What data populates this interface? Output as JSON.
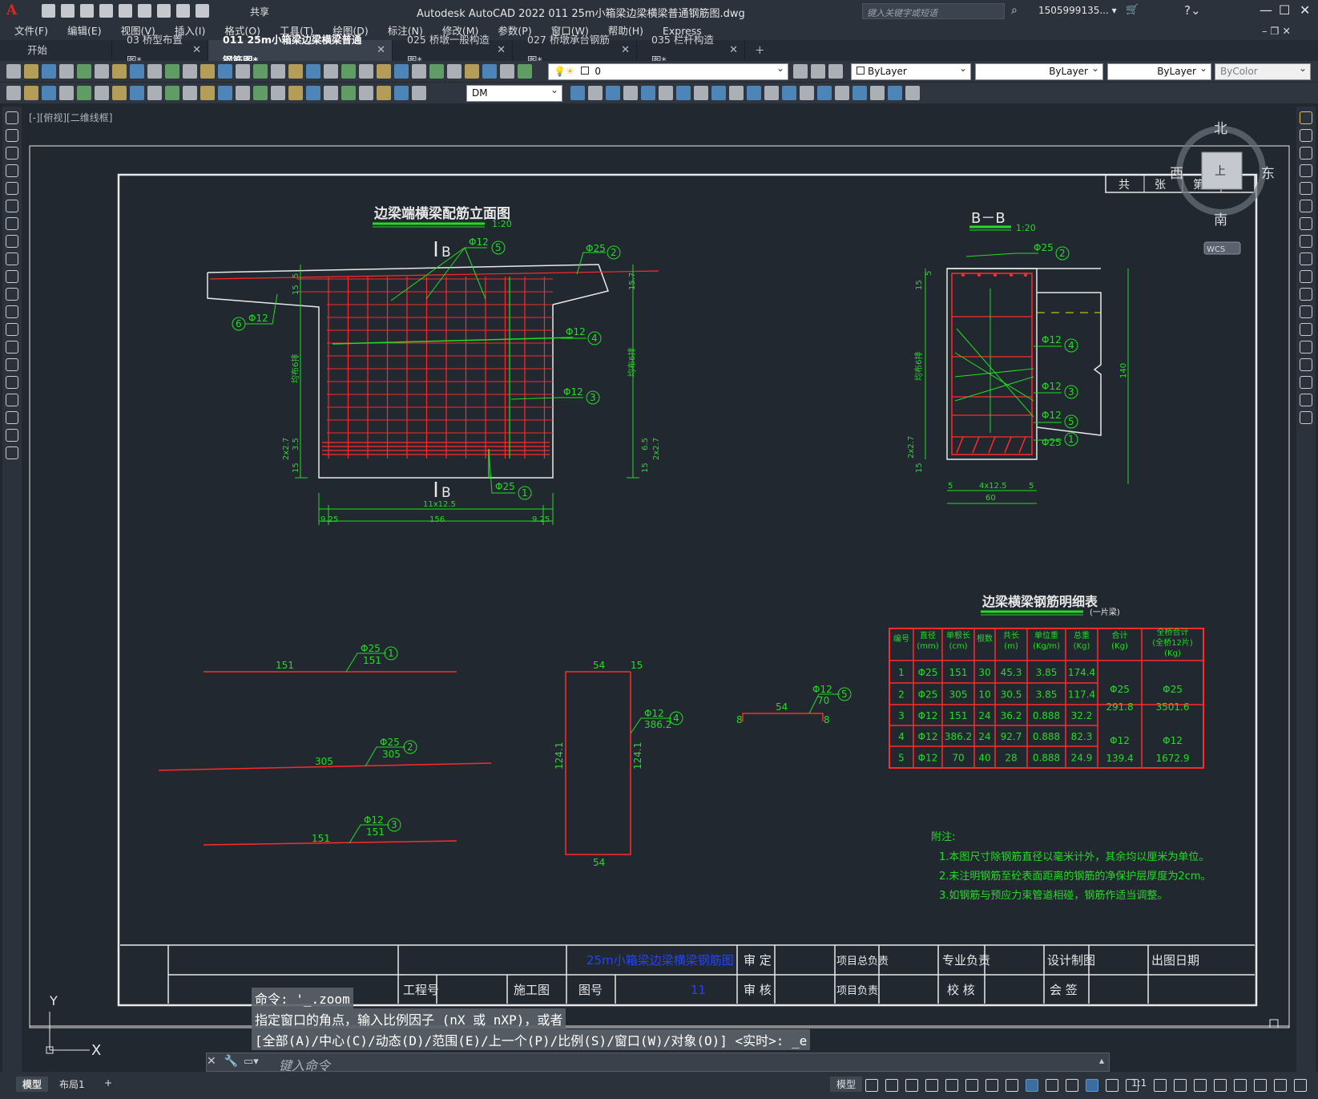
{
  "app": {
    "logo": "A",
    "share": "共享",
    "title": "Autodesk AutoCAD 2022    011 25m小箱梁边梁横梁普通钢筋图.dwg",
    "search_placeholder": "键入关键字或短语",
    "user": "1505999135... ▾"
  },
  "menu": [
    "文件(F)",
    "编辑(E)",
    "视图(V)",
    "插入(I)",
    "格式(O)",
    "工具(T)",
    "绘图(D)",
    "标注(N)",
    "修改(M)",
    "参数(P)",
    "窗口(W)",
    "帮助(H)",
    "Express"
  ],
  "tabs": [
    {
      "label": "开始",
      "closable": false
    },
    {
      "label": "03  桥型布置图*",
      "closable": true
    },
    {
      "label": "011 25m小箱梁边梁横梁普通钢筋图*",
      "closable": true,
      "active": true
    },
    {
      "label": "025 桥墩一般构造图*",
      "closable": true
    },
    {
      "label": "027 桥墩承台钢筋图*",
      "closable": true
    },
    {
      "label": "035 栏杆构造图*",
      "closable": true
    }
  ],
  "toolbar": {
    "layer_value": "0",
    "color": "ByLayer",
    "linetype": "ByLayer",
    "lineweight": "ByLayer",
    "plotstyle": "ByColor",
    "textstyle": "DM"
  },
  "viewport": {
    "label": "[-][俯视][二维线框]",
    "compass": {
      "north": "北",
      "south": "南",
      "east": "东",
      "west": "西",
      "ucs": "WCS"
    },
    "ucs_y": "Y",
    "ucs_x": "X"
  },
  "drawing": {
    "sheet_count": {
      "total": "共",
      "sheets": "张",
      "no": "第",
      "sheet": "张"
    },
    "elevation_title": "边梁端横梁配筋立面图",
    "elevation_scale": "1:20",
    "section_title": "B－B",
    "section_scale": "1:20",
    "section_marks": [
      "B",
      "B"
    ],
    "table_title": "边梁横梁钢筋明细表",
    "table_subtitle": "(一片梁)",
    "table_headers": [
      "编号",
      "直径\n(mm)",
      "单根长\n(cm)",
      "根数",
      "共长\n(m)",
      "单位重\n(Kg/m)",
      "总重\n(Kg)",
      "合计\n(Kg)",
      "全桥合计\n(全桥12片)\n(Kg)"
    ],
    "table_rows": [
      [
        "1",
        "Φ25",
        "151",
        "30",
        "45.3",
        "3.85",
        "174.4"
      ],
      [
        "2",
        "Φ25",
        "305",
        "10",
        "30.5",
        "3.85",
        "117.4"
      ],
      [
        "3",
        "Φ12",
        "151",
        "24",
        "36.2",
        "0.888",
        "32.2"
      ],
      [
        "4",
        "Φ12",
        "386.2",
        "24",
        "92.7",
        "0.888",
        "82.3"
      ],
      [
        "5",
        "Φ12",
        "70",
        "40",
        "28",
        "0.888",
        "24.9"
      ]
    ],
    "table_totals": {
      "d25_label": "Φ25",
      "d25_sum": "291.8",
      "d25_all": "3501.6",
      "d12_label": "Φ12",
      "d12_sum": "139.4",
      "d12_all": "1672.9"
    },
    "notes_title": "附注:",
    "notes": [
      "1.本图尺寸除钢筋直径以毫米计外，其余均以厘米为单位。",
      "2.未注明钢筋至砼表面距离的钢筋的净保护层厚度为2cm。",
      "3.如钢筋与预应力束管道相碰，钢筋作适当调整。"
    ],
    "titleblock": {
      "drawing_name": "25m小箱梁边梁横梁钢筋图",
      "project_no": "工程号",
      "stage": "施工图",
      "drawing_no": "图号",
      "drawing_no_value": "11",
      "approve": "审 定",
      "review": "审 核",
      "pm1": "项目总负责",
      "pm2": "项目负责",
      "specialty": "专业负责",
      "check": "校 核",
      "design": "设计制图",
      "countersign": "会 签",
      "date": "出图日期"
    },
    "bars": {
      "b1": {
        "tag": "Φ25",
        "num": "1",
        "len": "151",
        "side": "151"
      },
      "b2": {
        "tag": "Φ25",
        "num": "2",
        "len": "305",
        "side": "305"
      },
      "b3": {
        "tag": "Φ12",
        "num": "3",
        "len": "151",
        "side": "151"
      },
      "b4": {
        "tag": "Φ12",
        "num": "4",
        "top": "54",
        "top2": "15",
        "h": "124.1",
        "h2": "124.1",
        "bottom": "54",
        "len": "386.2"
      },
      "b5": {
        "tag": "Φ12",
        "num": "5",
        "len": "70",
        "mid": "54",
        "leg": "8"
      }
    },
    "elev_labels": {
      "n1": "Φ25",
      "n2": "Φ25",
      "n3": "Φ12",
      "n4": "Φ12",
      "n5": "Φ12",
      "n6": "Φ12",
      "dim_11x": "11x12.5",
      "dim_156": "156",
      "dim_925a": "9.25",
      "dim_925b": "9.25",
      "dim_5": "5",
      "dim_15": "15",
      "dim_157": "15.7",
      "dim_35": "3.5",
      "dim_2x27": "2x2.7",
      "dim_65": "6.5",
      "dim_15b": "15",
      "dim_spacing": "均布6排"
    },
    "sect_labels": {
      "dim_4x125": "4x12.5",
      "dim_60": "60",
      "dim_5a": "5",
      "dim_5b": "5",
      "dim_140": "140",
      "dim_15": "15",
      "dim_5": "5",
      "dim_2x27": "2x2.7",
      "dim_15b": "15",
      "dim_spacing": "均布6排"
    }
  },
  "command": {
    "history": [
      "命令: '_.zoom",
      "指定窗口的角点，输入比例因子 (nX 或 nXP)，或者",
      "[全部(A)/中心(C)/动态(D)/范围(E)/上一个(P)/比例(S)/窗口(W)/对象(O)] <实时>: _e"
    ],
    "placeholder": "键入命令"
  },
  "status": {
    "model_tab": "模型",
    "layout_tab": "布局1",
    "model_btn": "模型",
    "scale": "1:1"
  },
  "colors": {
    "red": "#ff2a2a",
    "green": "#22dd22",
    "white": "#e8e8e8",
    "blue": "#2244ff"
  }
}
